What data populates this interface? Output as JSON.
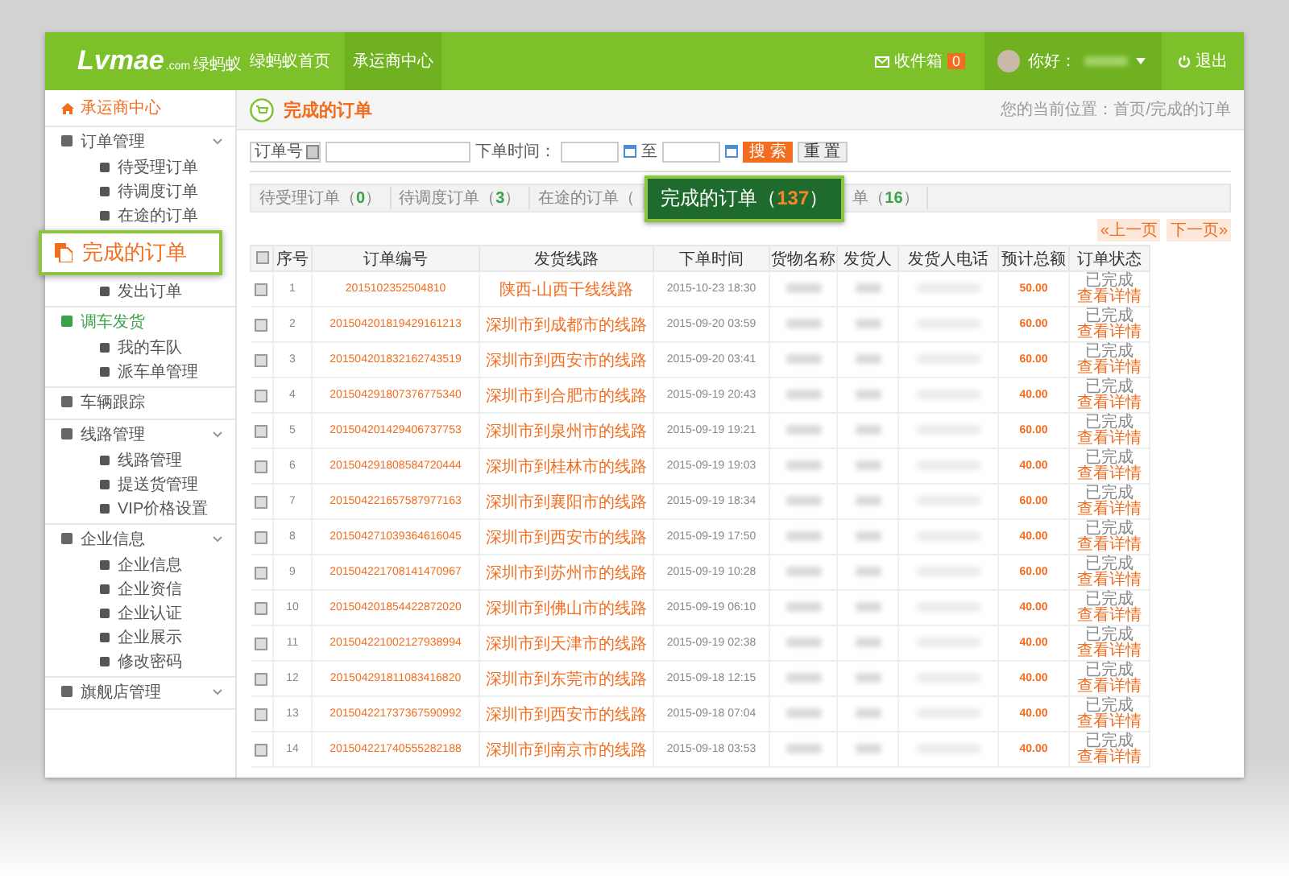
{
  "header": {
    "logo": "Lvmae",
    "logo_suffix": ".com",
    "logo_sub": "绿蚂蚁",
    "nav": [
      {
        "label": "绿蚂蚁首页",
        "selected": false
      },
      {
        "label": "承运商中心",
        "selected": true
      }
    ],
    "inbox": {
      "label": "收件箱",
      "count": "0"
    },
    "greeting": "你好：",
    "logout": "退出"
  },
  "sidebar": {
    "home": "承运商中心",
    "groups": [
      {
        "label": "订单管理",
        "chevron": true,
        "selected": false,
        "children": [
          {
            "kind": "item",
            "label": "待受理订单"
          },
          {
            "kind": "item",
            "label": "待调度订单"
          },
          {
            "kind": "item",
            "label": "在途的订单"
          },
          {
            "kind": "callout",
            "label": "完成的订单"
          },
          {
            "kind": "item",
            "label": "发出订单"
          }
        ]
      },
      {
        "label": "调车发货",
        "chevron": false,
        "selected": true,
        "children": [
          {
            "kind": "item",
            "label": "我的车队"
          },
          {
            "kind": "item",
            "label": "派车单管理"
          }
        ]
      },
      {
        "label": "车辆跟踪",
        "chevron": false,
        "selected": false
      },
      {
        "label": "线路管理",
        "chevron": true,
        "selected": false,
        "children": [
          {
            "kind": "item",
            "label": "线路管理"
          },
          {
            "kind": "item",
            "label": "提送货管理"
          },
          {
            "kind": "item",
            "label": "VIP价格设置"
          }
        ]
      },
      {
        "label": "企业信息",
        "chevron": true,
        "selected": false,
        "children": [
          {
            "kind": "item",
            "label": "企业信息"
          },
          {
            "kind": "item",
            "label": "企业资信"
          },
          {
            "kind": "item",
            "label": "企业认证"
          },
          {
            "kind": "item",
            "label": "企业展示"
          },
          {
            "kind": "item",
            "label": "修改密码"
          }
        ]
      },
      {
        "label": "旗舰店管理",
        "chevron": true,
        "selected": false
      }
    ]
  },
  "page_title": "完成的订单",
  "breadcrumb": "您的当前位置：首页/完成的订单",
  "search": {
    "select": "订单号",
    "time_label": "下单时间：",
    "to": "至",
    "search_button": "搜 索",
    "reset_button": "重 置"
  },
  "tabs": [
    {
      "label": "待受理订单（",
      "count": "0",
      "close": "）",
      "selected": false
    },
    {
      "label": "待调度订单（",
      "count": "3",
      "close": "）",
      "selected": false
    },
    {
      "label": "在途的订单（",
      "selected": false
    },
    {
      "label": "完成的订单（",
      "count": "137",
      "close": "）",
      "selected": true
    },
    {
      "label": "单（",
      "count": "16",
      "close": "）",
      "selected": false
    }
  ],
  "pager": {
    "prev": "«上一页",
    "next": "下一页»"
  },
  "table": {
    "select_all_checked": false,
    "columns": [
      "序号",
      "订单编号",
      "发货线路",
      "下单时间",
      "货物名称",
      "发货人",
      "发货人电话",
      "预计总额",
      "订单状态"
    ],
    "rows": [
      {
        "seq": "1",
        "no": "2015102352504810",
        "route": "陕西-山西干线线路",
        "time": "2015-10-23 18:30",
        "total": "50.00",
        "status": "已完成",
        "link": "查看详情",
        "checked": false
      },
      {
        "seq": "2",
        "no": "201504201819429161213",
        "route": "深圳市到成都市的线路",
        "time": "2015-09-20 03:59",
        "total": "60.00",
        "status": "已完成",
        "link": "查看详情",
        "checked": false
      },
      {
        "seq": "3",
        "no": "201504201832162743519",
        "route": "深圳市到西安市的线路",
        "time": "2015-09-20 03:41",
        "total": "60.00",
        "status": "已完成",
        "link": "查看详情",
        "checked": false
      },
      {
        "seq": "4",
        "no": "201504291807376775340",
        "route": "深圳市到合肥市的线路",
        "time": "2015-09-19 20:43",
        "total": "40.00",
        "status": "已完成",
        "link": "查看详情",
        "checked": false
      },
      {
        "seq": "5",
        "no": "201504201429406737753",
        "route": "深圳市到泉州市的线路",
        "time": "2015-09-19 19:21",
        "total": "60.00",
        "status": "已完成",
        "link": "查看详情",
        "checked": false
      },
      {
        "seq": "6",
        "no": "201504291808584720444",
        "route": "深圳市到桂林市的线路",
        "time": "2015-09-19 19:03",
        "total": "40.00",
        "status": "已完成",
        "link": "查看详情",
        "checked": false
      },
      {
        "seq": "7",
        "no": "201504221657587977163",
        "route": "深圳市到襄阳市的线路",
        "time": "2015-09-19 18:34",
        "total": "60.00",
        "status": "已完成",
        "link": "查看详情",
        "checked": false
      },
      {
        "seq": "8",
        "no": "201504271039364616045",
        "route": "深圳市到西安市的线路",
        "time": "2015-09-19 17:50",
        "total": "40.00",
        "status": "已完成",
        "link": "查看详情",
        "checked": false
      },
      {
        "seq": "9",
        "no": "201504221708141470967",
        "route": "深圳市到苏州市的线路",
        "time": "2015-09-19 10:28",
        "total": "60.00",
        "status": "已完成",
        "link": "查看详情",
        "checked": false
      },
      {
        "seq": "10",
        "no": "201504201854422872020",
        "route": "深圳市到佛山市的线路",
        "time": "2015-09-19 06:10",
        "total": "40.00",
        "status": "已完成",
        "link": "查看详情",
        "checked": false
      },
      {
        "seq": "11",
        "no": "201504221002127938994",
        "route": "深圳市到天津市的线路",
        "time": "2015-09-19 02:38",
        "total": "40.00",
        "status": "已完成",
        "link": "查看详情",
        "checked": false
      },
      {
        "seq": "12",
        "no": "201504291811083416820",
        "route": "深圳市到东莞市的线路",
        "time": "2015-09-18 12:15",
        "total": "40.00",
        "status": "已完成",
        "link": "查看详情",
        "checked": false
      },
      {
        "seq": "13",
        "no": "201504221737367590992",
        "route": "深圳市到西安市的线路",
        "time": "2015-09-18 07:04",
        "total": "40.00",
        "status": "已完成",
        "link": "查看详情",
        "checked": false
      },
      {
        "seq": "14",
        "no": "201504221740555282188",
        "route": "深圳市到南京市的线路",
        "time": "2015-09-18 03:53",
        "total": "40.00",
        "status": "已完成",
        "link": "查看详情",
        "checked": false
      }
    ]
  }
}
